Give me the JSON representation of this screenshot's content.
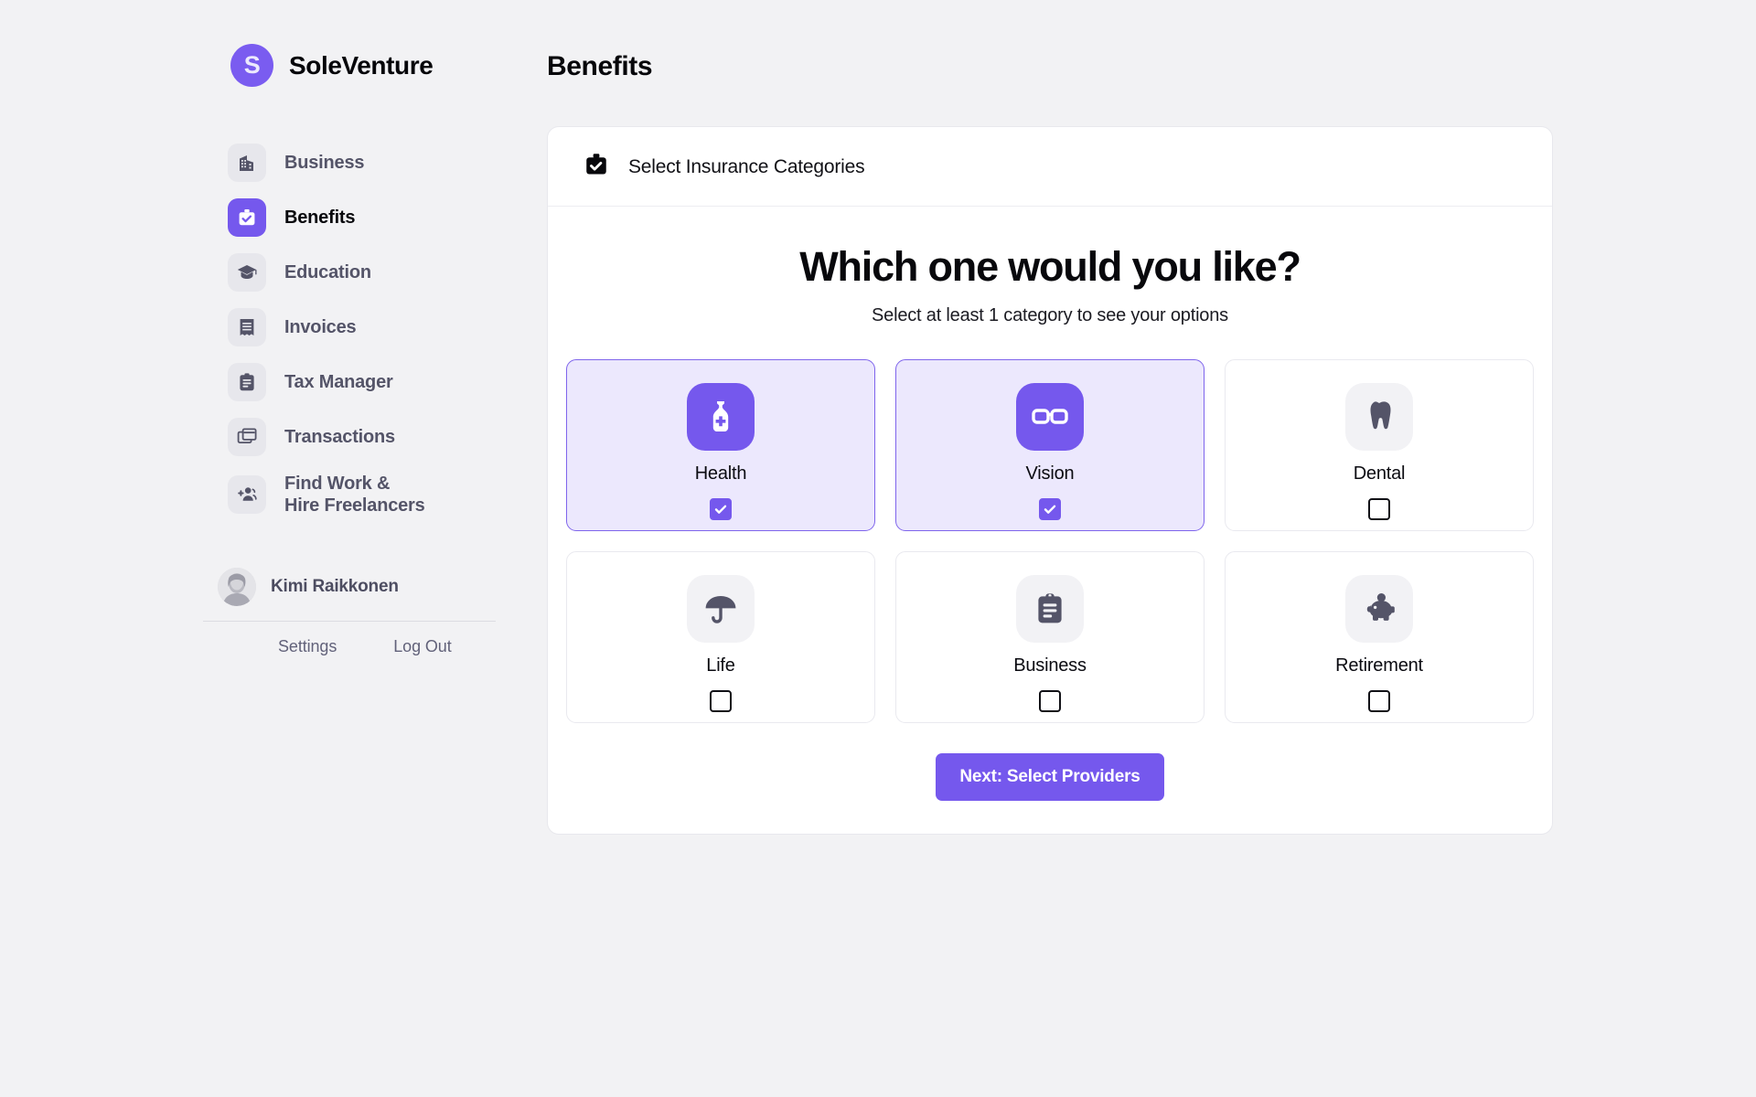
{
  "brand": {
    "logo_letter": "S",
    "name": "SoleVenture"
  },
  "sidebar": {
    "items": [
      {
        "label": "Business",
        "icon": "building-icon",
        "active": false
      },
      {
        "label": "Benefits",
        "icon": "briefcase-check-icon",
        "active": true
      },
      {
        "label": "Education",
        "icon": "graduation-cap-icon",
        "active": false
      },
      {
        "label": "Invoices",
        "icon": "receipt-icon",
        "active": false
      },
      {
        "label": "Tax Manager",
        "icon": "clipboard-icon",
        "active": false
      },
      {
        "label": "Transactions",
        "icon": "cards-stack-icon",
        "active": false
      },
      {
        "label": "Find Work &\nHire Freelancers",
        "icon": "add-person-icon",
        "active": false
      }
    ],
    "profile": {
      "name": "Kimi Raikkonen",
      "avatar": "user-avatar"
    },
    "bottom_links": [
      {
        "label": "Settings"
      },
      {
        "label": "Log Out"
      }
    ]
  },
  "main": {
    "page_title": "Benefits",
    "panel": {
      "header_icon": "briefcase-check-icon",
      "header_title": "Select Insurance Categories",
      "headline": "Which one would you like?",
      "subhead": "Select at least 1 category to see your options",
      "categories": [
        {
          "label": "Health",
          "icon": "medicine-bottle-icon",
          "selected": true
        },
        {
          "label": "Vision",
          "icon": "glasses-icon",
          "selected": true
        },
        {
          "label": "Dental",
          "icon": "tooth-icon",
          "selected": false
        },
        {
          "label": "Life",
          "icon": "umbrella-icon",
          "selected": false
        },
        {
          "label": "Business",
          "icon": "clipboard-icon",
          "selected": false
        },
        {
          "label": "Retirement",
          "icon": "piggy-bank-icon",
          "selected": false
        }
      ],
      "next_button": "Next: Select Providers"
    }
  },
  "colors": {
    "accent": "#7558ed",
    "accent_soft": "#ece8fd",
    "page_bg": "#f2f2f4",
    "icon_gray": "#545468",
    "tile_gray": "#f2f2f5"
  }
}
